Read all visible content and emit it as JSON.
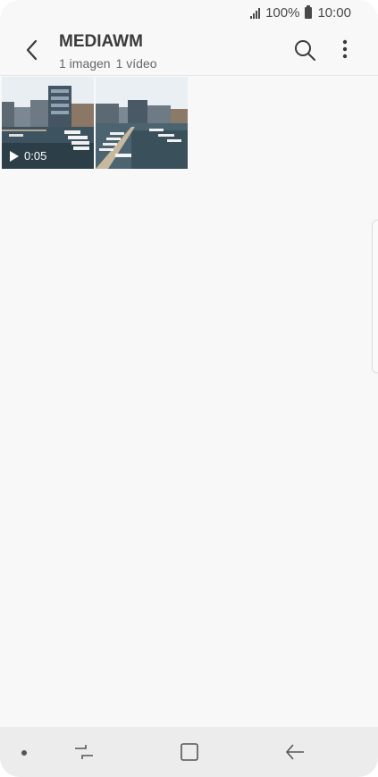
{
  "status_bar": {
    "battery_percent": "100%",
    "time": "10:00",
    "icons": [
      "signal-icon",
      "battery-icon"
    ]
  },
  "header": {
    "title": "MEDIAWM",
    "image_count": "1 imagen",
    "video_count": "1 vídeo",
    "icons": [
      "back-icon",
      "search-icon",
      "more-options-icon"
    ]
  },
  "grid": {
    "items": [
      {
        "type": "video",
        "duration": "0:05"
      },
      {
        "type": "image"
      }
    ]
  },
  "nav_bar": {
    "icons": [
      "dot-icon",
      "recent-apps-icon",
      "home-icon",
      "back-nav-icon"
    ]
  },
  "colors": {
    "background": "#f8f8f8",
    "text": "#3a3a3a",
    "nav_bar": "#ececec"
  }
}
